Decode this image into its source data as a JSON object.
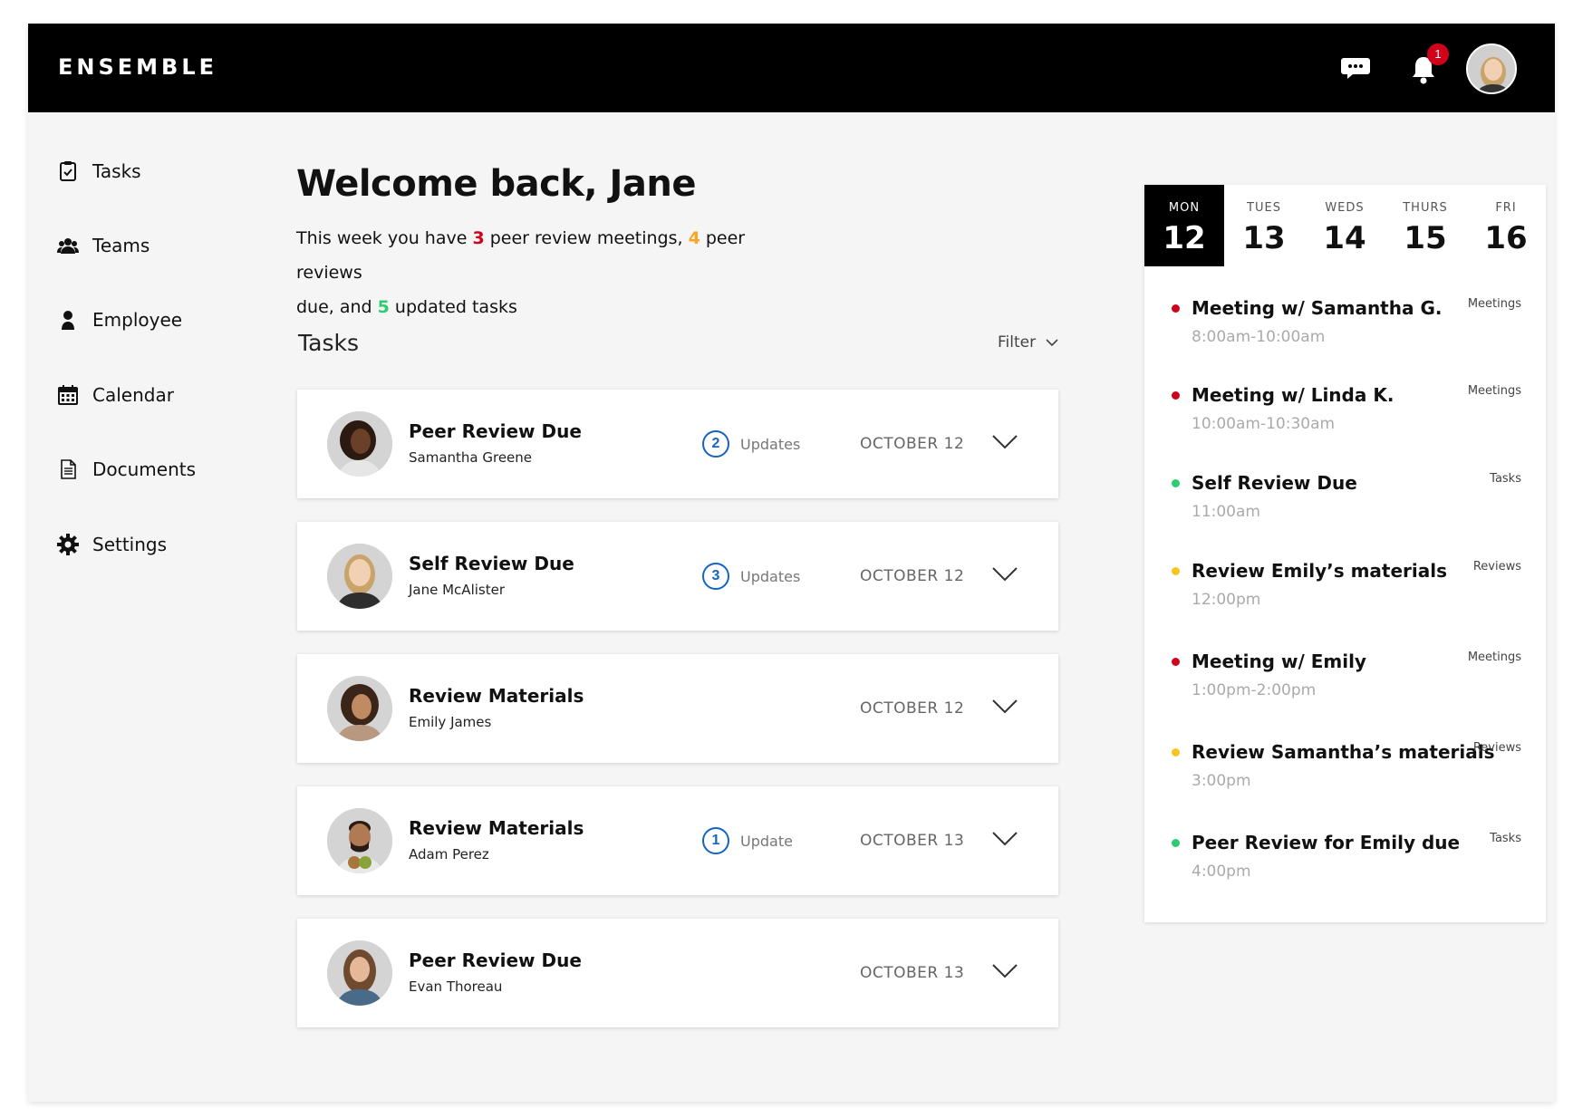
{
  "header": {
    "brand": "ENSEMBLE",
    "notification_count": "1",
    "icons": [
      "chat-icon",
      "bell-icon"
    ]
  },
  "sidebar": {
    "items": [
      {
        "label": "Tasks",
        "icon": "clipboard-check-icon"
      },
      {
        "label": "Teams",
        "icon": "team-icon"
      },
      {
        "label": "Employee",
        "icon": "person-icon"
      },
      {
        "label": "Calendar",
        "icon": "calendar-icon"
      },
      {
        "label": "Documents",
        "icon": "document-icon"
      },
      {
        "label": "Settings",
        "icon": "gear-icon"
      }
    ]
  },
  "main": {
    "welcome": "Welcome back, Jane",
    "summary": {
      "p1": "This week you have ",
      "meetings": "3",
      "p2": " peer review meetings, ",
      "reviews": "4",
      "p3": " peer reviews",
      "p4": "due, and ",
      "tasks": "5",
      "p5": " updated tasks"
    },
    "tasks_title": "Tasks",
    "filter_label": "Filter",
    "tasks": [
      {
        "title": "Peer Review Due",
        "person": "Samantha Greene",
        "updates_count": "2",
        "updates_label": "Updates",
        "date": "OCTOBER 12"
      },
      {
        "title": "Self Review Due",
        "person": "Jane McAlister",
        "updates_count": "3",
        "updates_label": "Updates",
        "date": "OCTOBER 12"
      },
      {
        "title": "Review Materials",
        "person": "Emily James",
        "updates_count": "",
        "updates_label": "",
        "date": "OCTOBER 12"
      },
      {
        "title": "Review Materials",
        "person": "Adam Perez",
        "updates_count": "1",
        "updates_label": "Update",
        "date": "OCTOBER 13"
      },
      {
        "title": "Peer Review Due",
        "person": "Evan Thoreau",
        "updates_count": "",
        "updates_label": "",
        "date": "OCTOBER 13"
      }
    ]
  },
  "calendar": {
    "days": [
      {
        "name": "MON",
        "num": "12",
        "active": true
      },
      {
        "name": "TUES",
        "num": "13"
      },
      {
        "name": "WEDS",
        "num": "14"
      },
      {
        "name": "THURS",
        "num": "15"
      },
      {
        "name": "FRI",
        "num": "16"
      }
    ],
    "events": [
      {
        "title": "Meeting w/ Samantha G.",
        "time": "8:00am-10:00am",
        "tag": "Meetings",
        "color": "#d0021b"
      },
      {
        "title": "Meeting w/ Linda K.",
        "time": "10:00am-10:30am",
        "tag": "Meetings",
        "color": "#d0021b"
      },
      {
        "title": "Self Review Due",
        "time": "11:00am",
        "tag": "Tasks",
        "color": "#2ecc71"
      },
      {
        "title": "Review Emily’s materials",
        "time": "12:00pm",
        "tag": "Reviews",
        "color": "#f8c51c"
      },
      {
        "title": "Meeting w/ Emily",
        "time": "1:00pm-2:00pm",
        "tag": "Meetings",
        "color": "#d0021b"
      },
      {
        "title": "Review Samantha’s materials",
        "time": "3:00pm",
        "tag": "Reviews",
        "color": "#f8c51c"
      },
      {
        "title": "Peer Review for Emily due",
        "time": "4:00pm",
        "tag": "Tasks",
        "color": "#2ecc71"
      }
    ]
  },
  "colors": {
    "header_bg": "#000000",
    "accent_blue": "#1565c0",
    "meeting_red": "#d0021b",
    "task_green": "#2ecc71",
    "review_yellow": "#f8c51c"
  }
}
